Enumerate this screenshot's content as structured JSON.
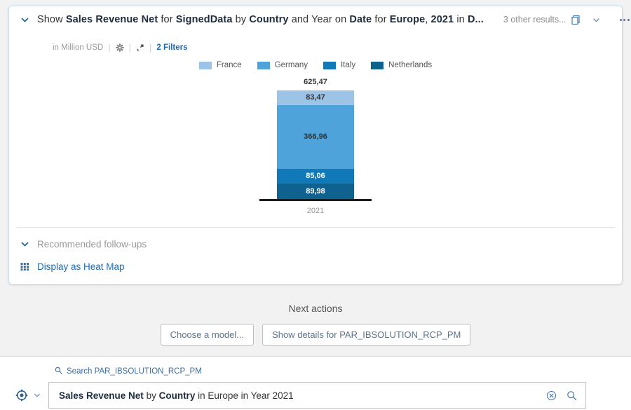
{
  "card": {
    "collapse_icon": "chevron-down-icon",
    "title_parts": [
      {
        "t": "Show ",
        "b": false
      },
      {
        "t": "Sales Revenue Net",
        "b": true
      },
      {
        "t": " for ",
        "b": false
      },
      {
        "t": "SignedData",
        "b": true
      },
      {
        "t": " by ",
        "b": false
      },
      {
        "t": "Country",
        "b": true
      },
      {
        "t": " and Year on ",
        "b": false
      },
      {
        "t": "Date",
        "b": true
      },
      {
        "t": " for ",
        "b": false
      },
      {
        "t": "Europe",
        "b": true
      },
      {
        "t": ", ",
        "b": false
      },
      {
        "t": "2021",
        "b": true
      },
      {
        "t": " in ",
        "b": false
      },
      {
        "t": "D...",
        "b": true
      }
    ],
    "other_results": "3 other results...",
    "copy_icon": "duplicate-icon",
    "dropdown_icon": "chevron-down-icon",
    "overflow_icon": "more-options-icon",
    "units_label": "in Million USD",
    "settings_icon": "gear-icon",
    "drill_icon": "drill-arrow-icon",
    "filters_label": "2 Filters",
    "separator": "|"
  },
  "chart_data": {
    "type": "bar",
    "subtype": "stacked-column",
    "title": "",
    "units": "in Million USD",
    "categories": [
      "2021"
    ],
    "xlabel": "",
    "ylabel": "",
    "grid": false,
    "legend_position": "top",
    "total_label": "625,47",
    "total_value": 625.47,
    "series": [
      {
        "name": "France",
        "values": [
          83.47
        ],
        "label": "83,47",
        "color": "#9dc3e6",
        "text_color": "#333333"
      },
      {
        "name": "Germany",
        "values": [
          366.96
        ],
        "label": "366,96",
        "color": "#4fa3db",
        "text_color": "#333333"
      },
      {
        "name": "Italy",
        "values": [
          85.06
        ],
        "label": "85,06",
        "color": "#1279b8",
        "text_color": "#ffffff"
      },
      {
        "name": "Netherlands",
        "values": [
          89.98
        ],
        "label": "89,98",
        "color": "#10628e",
        "text_color": "#ffffff"
      }
    ]
  },
  "followups": {
    "chevron_icon": "chevron-down-icon",
    "label": "Recommended follow-ups",
    "heatmap_icon": "grid-icon",
    "heatmap_label": "Display as Heat Map"
  },
  "next_actions": {
    "title": "Next actions",
    "buttons": [
      {
        "label": "Choose a model..."
      },
      {
        "label": "Show details for PAR_IBSOLUTION_RCP_PM"
      }
    ]
  },
  "search": {
    "hint_icon": "search-icon",
    "hint": "Search PAR_IBSOLUTION_RCP_PM",
    "model_icon": "model-icon",
    "model_chevron_icon": "chevron-down-icon",
    "value_parts": [
      {
        "t": "Sales Revenue Net",
        "b": true
      },
      {
        "t": " by ",
        "b": false
      },
      {
        "t": "Country",
        "b": true
      },
      {
        "t": " in Europe in Year 2021",
        "b": false
      }
    ],
    "clear_icon": "clear-circle-icon",
    "submit_icon": "search-icon"
  },
  "colors": {
    "accent": "#1b6bb5",
    "card_border": "#c8dcf0",
    "baseline": "#1a1a1a"
  }
}
